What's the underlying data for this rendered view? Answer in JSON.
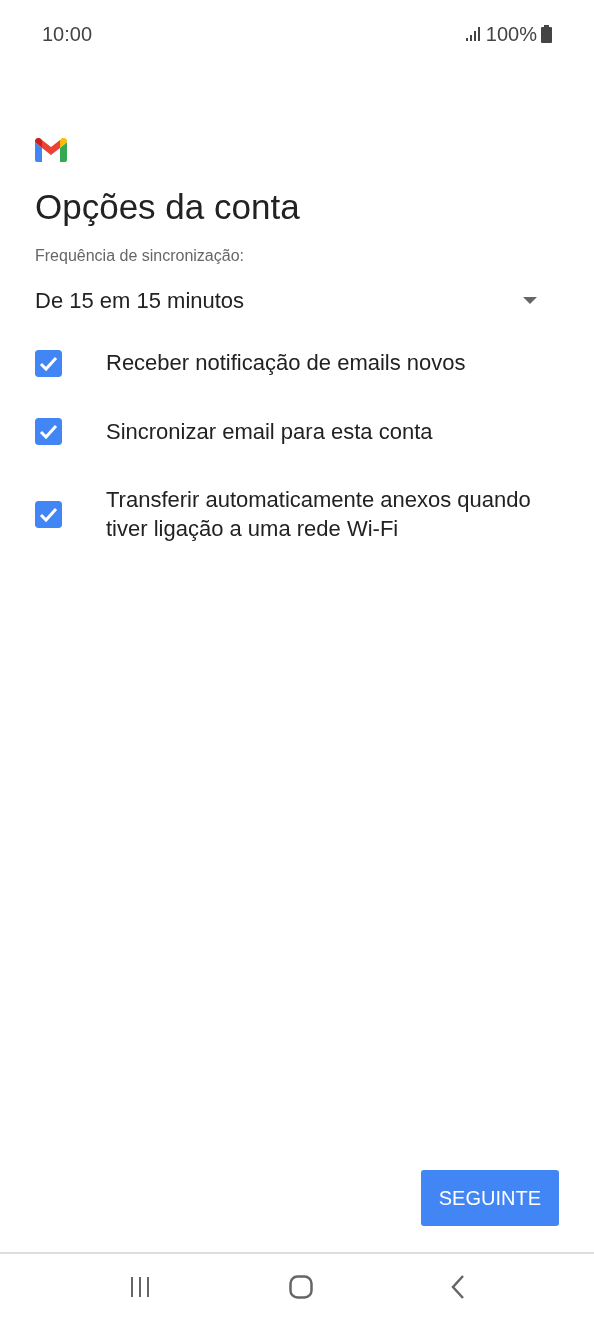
{
  "status_bar": {
    "time": "10:00",
    "battery": "100%"
  },
  "title": "Opções da conta",
  "sync": {
    "label": "Frequência de sincronização:",
    "value": "De 15 em 15 minutos"
  },
  "options": [
    {
      "label": "Receber notificação de emails novos",
      "checked": true
    },
    {
      "label": "Sincronizar email para esta conta",
      "checked": true
    },
    {
      "label": "Transferir automaticamente anexos quando tiver ligação a uma rede Wi-Fi",
      "checked": true
    }
  ],
  "next_button": "SEGUINTE"
}
